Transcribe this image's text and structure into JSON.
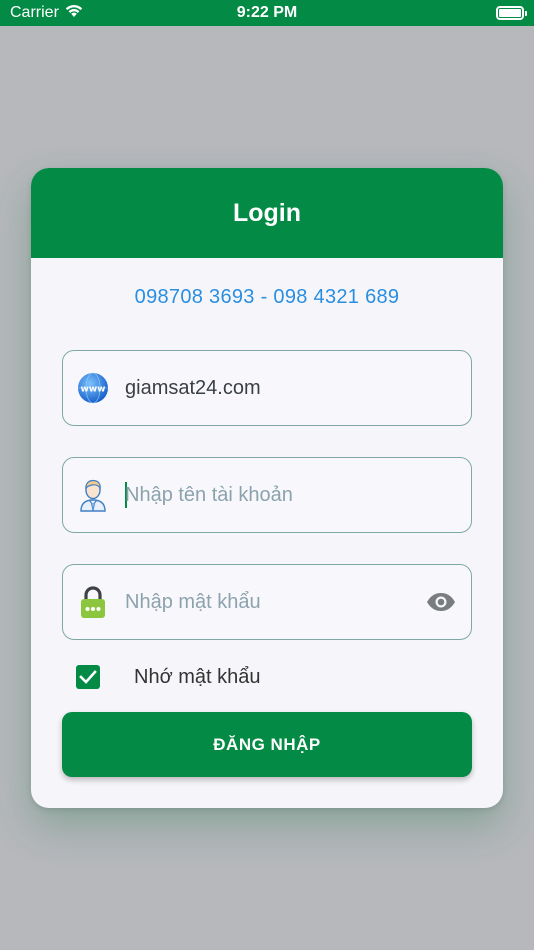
{
  "status_bar": {
    "carrier": "Carrier",
    "time": "9:22 PM",
    "icons": [
      "wifi-icon",
      "battery-icon"
    ]
  },
  "login_card": {
    "title": "Login",
    "hotline": "098708 3693 - 098 4321 689",
    "server_field": {
      "icon": "www-globe-icon",
      "value": "giamsat24.com"
    },
    "username_field": {
      "icon": "user-avatar-icon",
      "value": "",
      "placeholder": "Nhập tên tài khoản"
    },
    "password_field": {
      "icon": "lock-icon",
      "value": "",
      "placeholder": "Nhập mật khẩu",
      "toggle_icon": "eye-icon"
    },
    "remember": {
      "checked": true,
      "label": "Nhớ mật khẩu"
    },
    "submit_label": "ĐĂNG NHẬP"
  },
  "colors": {
    "brand_green": "#038a45",
    "hotline_blue": "#2a8ee0",
    "backdrop": "#b6b8bc",
    "field_border": "#7fa8a5"
  }
}
